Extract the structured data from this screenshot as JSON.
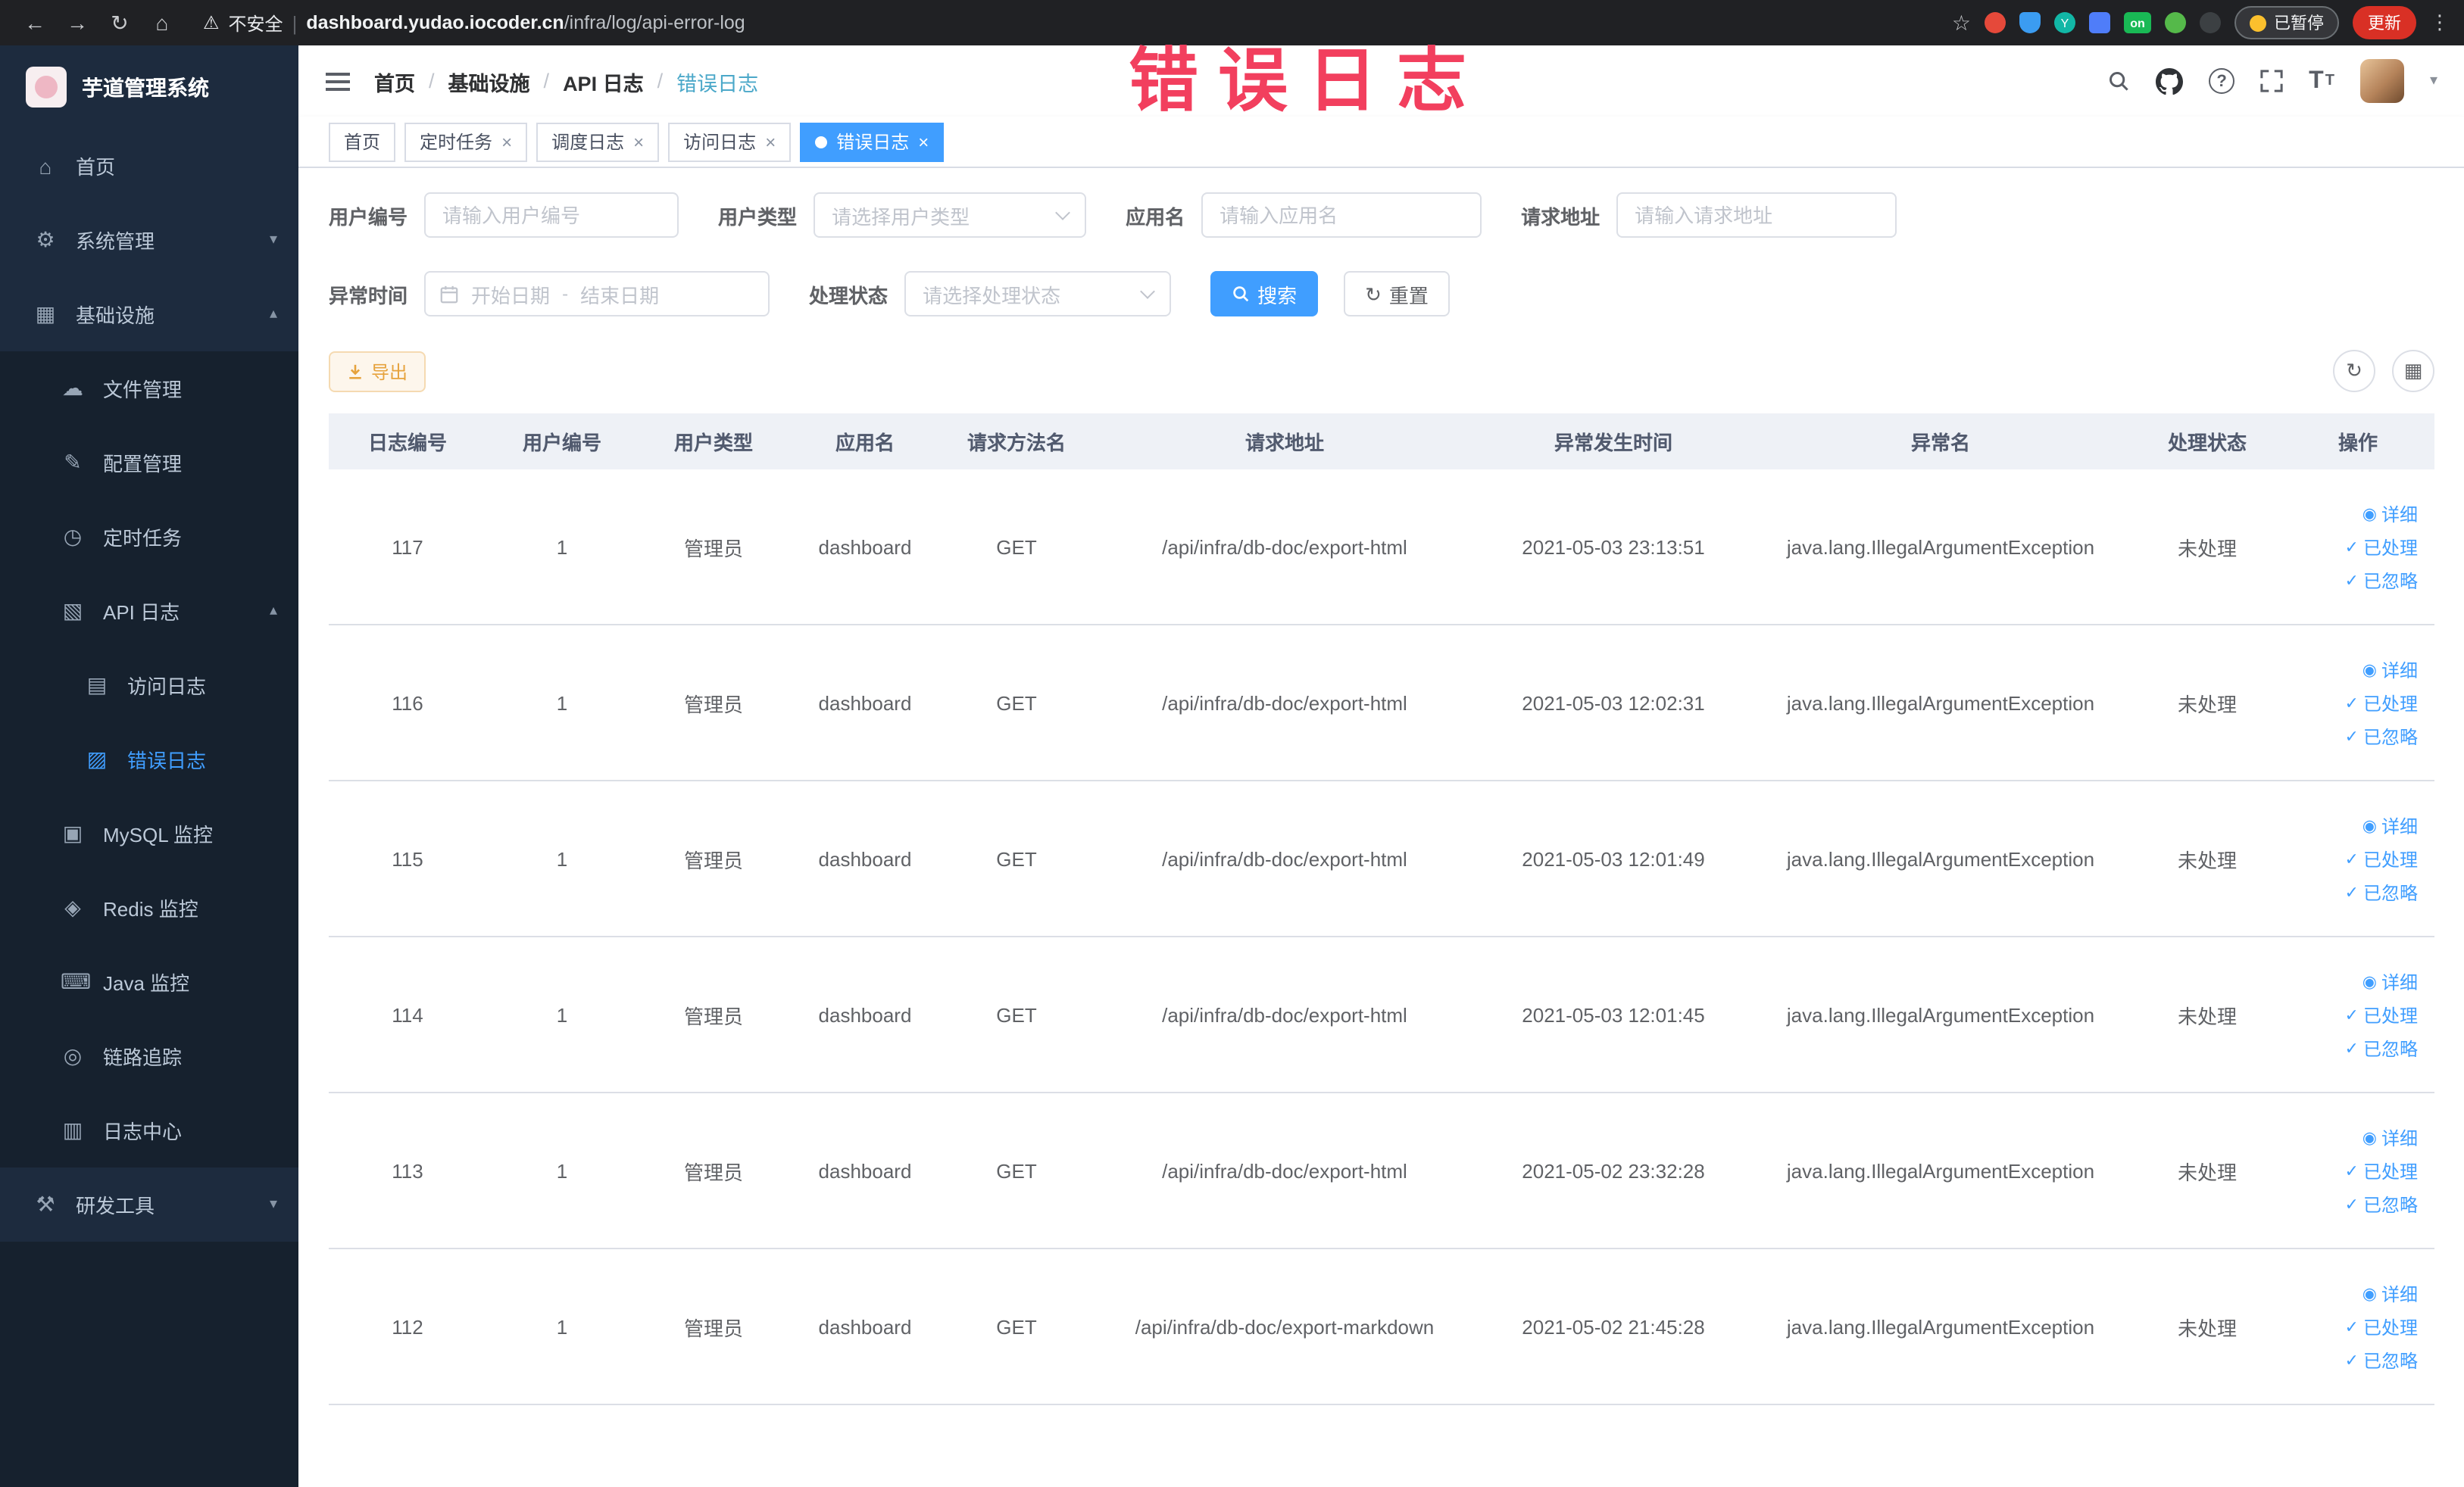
{
  "browser": {
    "security_label": "不安全",
    "url_domain": "dashboard.yudao.iocoder.cn",
    "url_path": "/infra/log/api-error-log",
    "url_separator": "|",
    "paused_label": "已暂停",
    "update_label": "更新",
    "ext_on": "on",
    "ext_y": "Y"
  },
  "icons": {
    "back": "←",
    "forward": "→",
    "reload": "↻",
    "nav_home": "⌂",
    "warning": "⚠",
    "star": "☆",
    "kebab": "⋮",
    "home": "⌂",
    "gear": "⚙",
    "infra": "▦",
    "cloud": "☁",
    "edit": "✎",
    "timer": "◷",
    "api_log": "▧",
    "access_log": "▤",
    "error_log": "▨",
    "mysql": "▣",
    "redis": "◈",
    "java": "⌨",
    "trace": "◎",
    "log_center": "▥",
    "tools": "⚒",
    "caret_down": "▾",
    "caret_up": "▴",
    "close": "×",
    "eye": "◉",
    "check": "✓",
    "refresh": "↻",
    "grid": "▦",
    "question": "?",
    "font_large": "T",
    "font_small": "T"
  },
  "sidebar": {
    "logo_title": "芋道管理系统",
    "items": [
      {
        "label": "首页"
      },
      {
        "label": "系统管理"
      },
      {
        "label": "基础设施"
      },
      {
        "label": "文件管理"
      },
      {
        "label": "配置管理"
      },
      {
        "label": "定时任务"
      },
      {
        "label": "API 日志"
      },
      {
        "label": "访问日志"
      },
      {
        "label": "错误日志"
      },
      {
        "label": "MySQL 监控"
      },
      {
        "label": "Redis 监控"
      },
      {
        "label": "Java 监控"
      },
      {
        "label": "链路追踪"
      },
      {
        "label": "日志中心"
      },
      {
        "label": "研发工具"
      }
    ]
  },
  "nav": {
    "breadcrumb": [
      "首页",
      "基础设施",
      "API 日志",
      "错误日志"
    ],
    "separator": "/"
  },
  "tabs": [
    {
      "label": "首页"
    },
    {
      "label": "定时任务"
    },
    {
      "label": "调度日志"
    },
    {
      "label": "访问日志"
    },
    {
      "label": "错误日志"
    }
  ],
  "filters": {
    "user_id": {
      "label": "用户编号",
      "placeholder": "请输入用户编号"
    },
    "user_type": {
      "label": "用户类型",
      "placeholder": "请选择用户类型"
    },
    "app_name": {
      "label": "应用名",
      "placeholder": "请输入应用名"
    },
    "request_url": {
      "label": "请求地址",
      "placeholder": "请输入请求地址"
    },
    "exception_time": {
      "label": "异常时间",
      "start_placeholder": "开始日期",
      "separator": "-",
      "end_placeholder": "结束日期"
    },
    "process_status": {
      "label": "处理状态",
      "placeholder": "请选择处理状态"
    },
    "search_label": "搜索",
    "reset_label": "重置"
  },
  "toolbar": {
    "export_label": "导出"
  },
  "table": {
    "headers": [
      "日志编号",
      "用户编号",
      "用户类型",
      "应用名",
      "请求方法名",
      "请求地址",
      "异常发生时间",
      "异常名",
      "处理状态",
      "操作"
    ],
    "action_labels": {
      "detail": "详细",
      "processed": "已处理",
      "ignored": "已忽略"
    },
    "rows": [
      {
        "log_id": "117",
        "user_id": "1",
        "user_type": "管理员",
        "app_name": "dashboard",
        "method": "GET",
        "url": "/api/infra/db-doc/export-html",
        "time": "2021-05-03 23:13:51",
        "exception": "java.lang.IllegalArgumentException",
        "status": "未处理"
      },
      {
        "log_id": "116",
        "user_id": "1",
        "user_type": "管理员",
        "app_name": "dashboard",
        "method": "GET",
        "url": "/api/infra/db-doc/export-html",
        "time": "2021-05-03 12:02:31",
        "exception": "java.lang.IllegalArgumentException",
        "status": "未处理"
      },
      {
        "log_id": "115",
        "user_id": "1",
        "user_type": "管理员",
        "app_name": "dashboard",
        "method": "GET",
        "url": "/api/infra/db-doc/export-html",
        "time": "2021-05-03 12:01:49",
        "exception": "java.lang.IllegalArgumentException",
        "status": "未处理"
      },
      {
        "log_id": "114",
        "user_id": "1",
        "user_type": "管理员",
        "app_name": "dashboard",
        "method": "GET",
        "url": "/api/infra/db-doc/export-html",
        "time": "2021-05-03 12:01:45",
        "exception": "java.lang.IllegalArgumentException",
        "status": "未处理"
      },
      {
        "log_id": "113",
        "user_id": "1",
        "user_type": "管理员",
        "app_name": "dashboard",
        "method": "GET",
        "url": "/api/infra/db-doc/export-html",
        "time": "2021-05-02 23:32:28",
        "exception": "java.lang.IllegalArgumentException",
        "status": "未处理"
      },
      {
        "log_id": "112",
        "user_id": "1",
        "user_type": "管理员",
        "app_name": "dashboard",
        "method": "GET",
        "url": "/api/infra/db-doc/export-markdown",
        "time": "2021-05-02 21:45:28",
        "exception": "java.lang.IllegalArgumentException",
        "status": "未处理"
      }
    ]
  },
  "annotation": {
    "text": "错误日志"
  },
  "colors": {
    "primary": "#409eff",
    "warning": "#e6a23c",
    "annotation_red": "#f23f5e",
    "sidebar_bg": "#1d2b3e",
    "submenu_bg": "#16212e",
    "table_header_bg": "#eef1f6",
    "update_button_red": "#d93025"
  }
}
